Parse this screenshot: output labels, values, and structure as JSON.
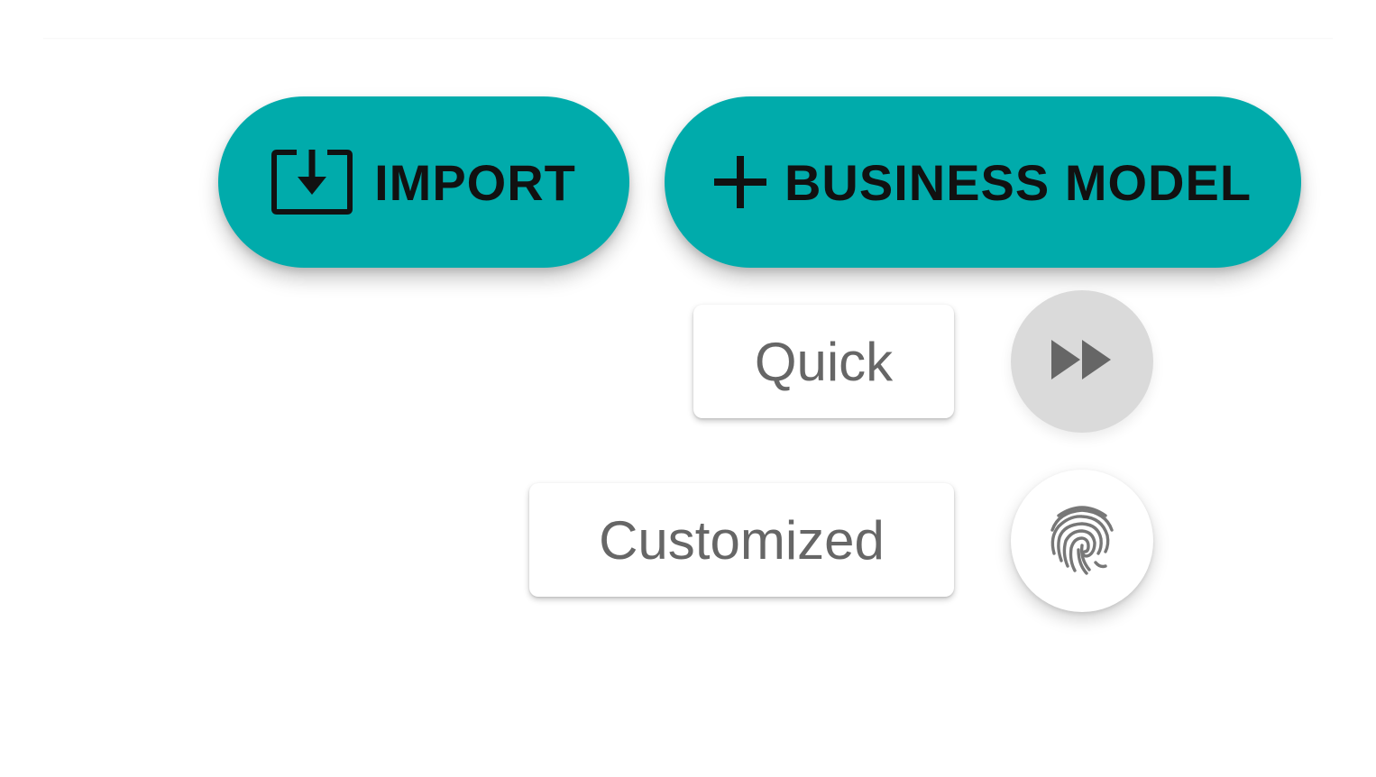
{
  "actions": {
    "import_label": "IMPORT",
    "business_model_label": "BUSINESS MODEL"
  },
  "speed_dial": {
    "quick_label": "Quick",
    "customized_label": "Customized"
  },
  "icons": {
    "import": "import-tray-icon",
    "add": "plus-icon",
    "quick": "fast-forward-icon",
    "customized": "fingerprint-icon"
  },
  "colors": {
    "primary": "#00ABAB",
    "text_dark": "#111111",
    "chip_text": "#666666",
    "fab_quick_bg": "#DADADA",
    "fab_custom_bg": "#FFFFFF",
    "icon_gray": "#666666"
  }
}
